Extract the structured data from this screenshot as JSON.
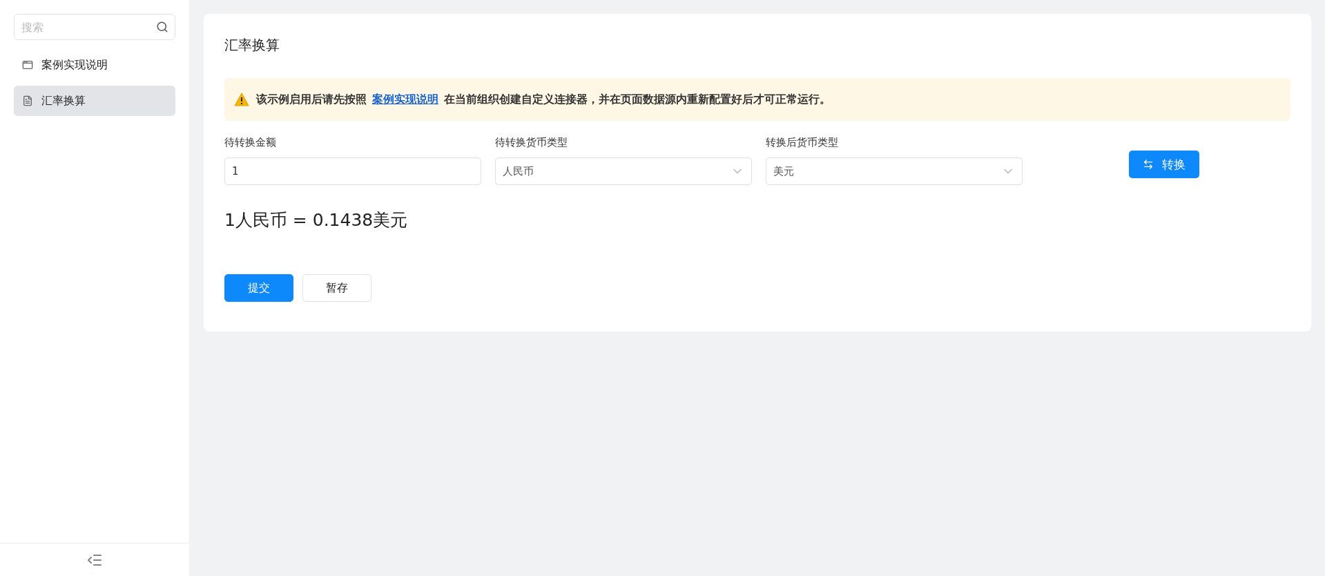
{
  "sidebar": {
    "search": {
      "placeholder": "搜索"
    },
    "items": [
      {
        "label": "案例实现说明",
        "kind": "page",
        "selected": false
      },
      {
        "label": "汇率换算",
        "kind": "doc",
        "selected": true
      }
    ]
  },
  "page": {
    "title": "汇率换算",
    "alert": {
      "before": "该示例启用后请先按照",
      "link": "案例实现说明",
      "after": "在当前组织创建自定义连接器，并在页面数据源内重新配置好后才可正常运行。"
    },
    "fields": [
      {
        "label": "待转换金额",
        "kind": "input",
        "value": "1"
      },
      {
        "label": "待转换货币类型",
        "kind": "select",
        "value": "人民币"
      },
      {
        "label": "转换后货币类型",
        "kind": "select",
        "value": "美元"
      }
    ],
    "convert_button": "转换",
    "result": "1人民币 = 0.1438美元",
    "buttons": [
      {
        "label": "提交",
        "kind": "primary"
      },
      {
        "label": "暂存",
        "kind": "default"
      }
    ]
  }
}
